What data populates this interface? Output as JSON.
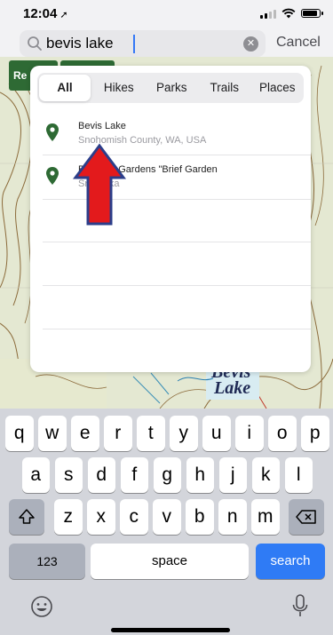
{
  "status": {
    "time": "12:04",
    "location_arrow": "➚"
  },
  "search": {
    "query": "bevis lake",
    "cancel_label": "Cancel",
    "clear_glyph": "✕"
  },
  "map": {
    "chips": [
      "Re",
      ""
    ],
    "lake_label_line1": "Bevis",
    "lake_label_line2": "Lake"
  },
  "tabs": [
    {
      "label": "All",
      "active": true
    },
    {
      "label": "Hikes",
      "active": false
    },
    {
      "label": "Parks",
      "active": false
    },
    {
      "label": "Trails",
      "active": false
    },
    {
      "label": "Places",
      "active": false
    }
  ],
  "results": [
    {
      "title": "Bevis Lake",
      "subtitle": "Snohomish County, WA, USA"
    },
    {
      "title": "Bellevue Gardens \"Brief Garden",
      "subtitle": "Sri Lanka"
    }
  ],
  "colors": {
    "pin": "#2e6a34",
    "accent": "#2f7bf5",
    "arrow_fill": "#e31a1c",
    "arrow_stroke": "#2c3e8a"
  },
  "keyboard": {
    "row1": [
      "q",
      "w",
      "e",
      "r",
      "t",
      "y",
      "u",
      "i",
      "o",
      "p"
    ],
    "row2": [
      "a",
      "s",
      "d",
      "f",
      "g",
      "h",
      "j",
      "k",
      "l"
    ],
    "row3": [
      "z",
      "x",
      "c",
      "v",
      "b",
      "n",
      "m"
    ],
    "numbers_label": "123",
    "space_label": "space",
    "search_label": "search"
  }
}
